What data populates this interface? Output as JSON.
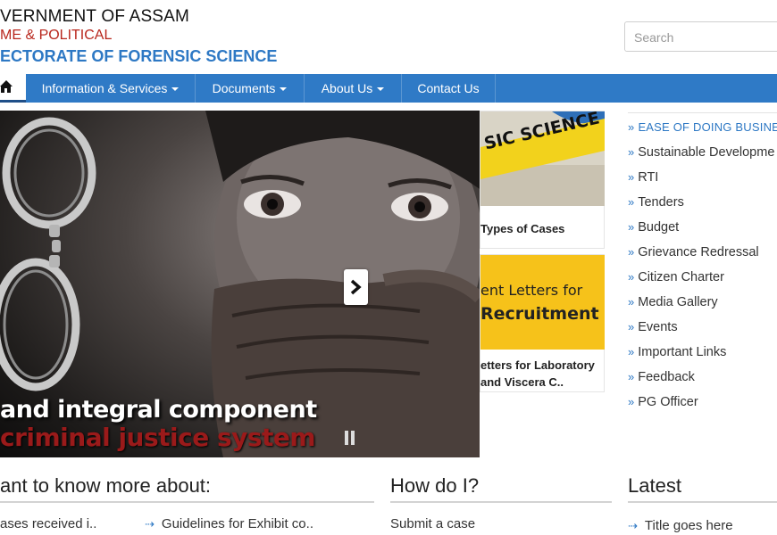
{
  "header": {
    "line1": "VERNMENT OF ASSAM",
    "line2": "ME & POLITICAL",
    "line3": "ECTORATE OF FORENSIC SCIENCE",
    "search_placeholder": "Search"
  },
  "nav": {
    "items": [
      {
        "label": "Information & Services"
      },
      {
        "label": "Documents"
      },
      {
        "label": "About Us"
      },
      {
        "label": "Contact Us"
      }
    ]
  },
  "slider": {
    "caption_line1": "and integral component",
    "caption_line2": "criminal justice system"
  },
  "cards": [
    {
      "image_text": "SIC SCIENCE",
      "title_line1": "Types of Cases",
      "title_line2": ""
    },
    {
      "image_text_line1": "ent Letters for",
      "image_text_line2": "Recruitment",
      "title_line1": "etters for Laboratory",
      "title_line2": "and Viscera C.."
    }
  ],
  "side_links": [
    "EASE OF DOING BUSINESS",
    "Sustainable Developme",
    "RTI",
    "Tenders",
    "Budget",
    "Grievance Redressal",
    "Citizen Charter",
    "Media Gallery",
    "Events",
    "Important Links",
    "Feedback",
    "PG Officer"
  ],
  "sections": {
    "know_more": {
      "title": "ant to know more about:",
      "link1": "ases received i..",
      "link2": "Guidelines for Exhibit co.."
    },
    "how_do_i": {
      "title": "How do I?",
      "link1": "Submit a case"
    },
    "latest": {
      "title": "Latest",
      "link1": "Title goes here"
    }
  },
  "colors": {
    "nav_bg": "#2f7ac6",
    "accent_blue": "#2d78c4",
    "accent_red": "#b8261c"
  }
}
